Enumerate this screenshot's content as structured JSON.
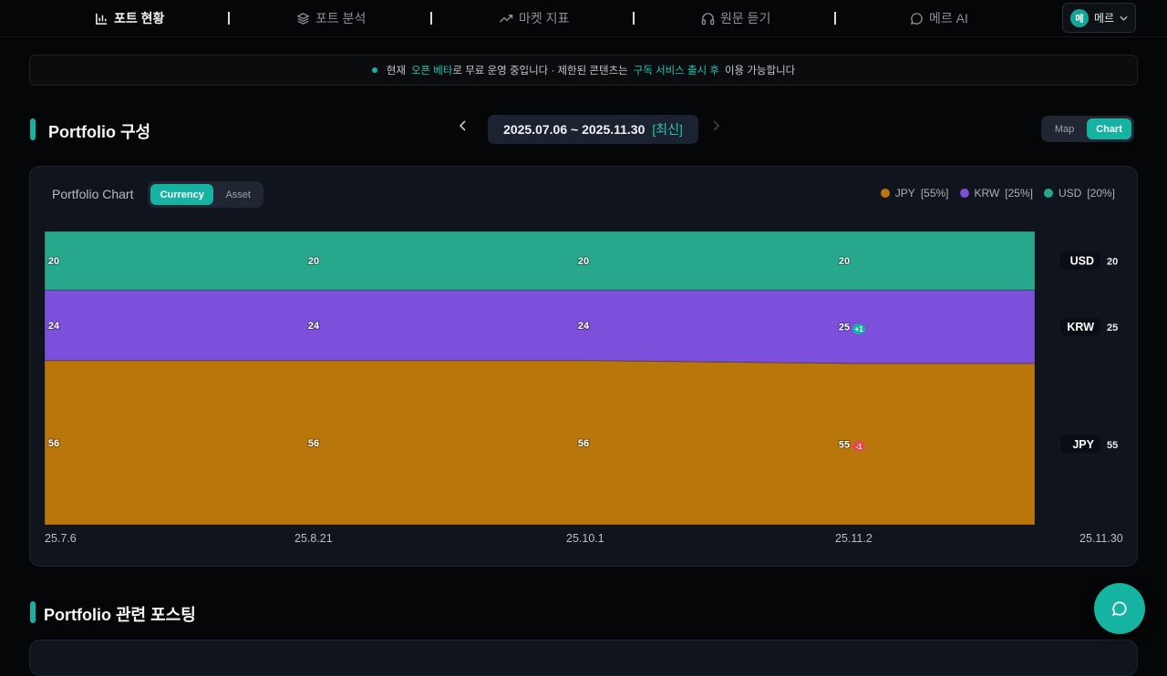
{
  "nav": {
    "items": [
      {
        "label": "포트 현황",
        "icon": "bar-chart-icon",
        "active": true
      },
      {
        "label": "포트 분석",
        "icon": "layers-icon",
        "active": false
      },
      {
        "label": "마켓 지표",
        "icon": "trend-up-icon",
        "active": false
      },
      {
        "label": "원문 듣기",
        "icon": "headphones-icon",
        "active": false
      },
      {
        "label": "메르 AI",
        "icon": "chat-bubble-icon",
        "active": false
      }
    ],
    "user": {
      "avatar_text": "메",
      "name": "메르"
    }
  },
  "banner": {
    "prefix": "현재",
    "hl1": "오픈 베타",
    "mid": "로 무료 운영 중입니다 · 제한된 콘텐츠는",
    "hl2": "구독 서비스 출시 후",
    "suffix": "이용 가능합니다"
  },
  "portfolio": {
    "title": "Portfolio 구성",
    "date_range": "2025.07.06 ~ 2025.11.30",
    "date_tag": "[최신]",
    "view_toggle": {
      "map": "Map",
      "chart": "Chart",
      "selected": "Chart"
    }
  },
  "chart_card": {
    "title": "Portfolio Chart",
    "mode_toggle": {
      "currency": "Currency",
      "asset": "Asset",
      "selected": "Currency"
    },
    "legend": [
      {
        "name": "JPY",
        "pct": "[55%]",
        "color": "#b8760b"
      },
      {
        "name": "KRW",
        "pct": "[25%]",
        "color": "#7c50db"
      },
      {
        "name": "USD",
        "pct": "[20%]",
        "color": "#27a88d"
      }
    ]
  },
  "chart_data": {
    "type": "area",
    "stacked": true,
    "normalized": true,
    "x": [
      "25.7.6",
      "25.8.21",
      "25.10.1",
      "25.11.2",
      "25.11.30"
    ],
    "series": [
      {
        "name": "JPY",
        "color": "#b8760b",
        "values": [
          56,
          56,
          56,
          55,
          55
        ],
        "labels": [
          "56",
          "56",
          "56",
          "55"
        ],
        "change": [
          null,
          null,
          null,
          "-1"
        ],
        "end_value": "55"
      },
      {
        "name": "KRW",
        "color": "#7c50db",
        "values": [
          24,
          24,
          24,
          25,
          25
        ],
        "labels": [
          "24",
          "24",
          "24",
          "25"
        ],
        "change": [
          null,
          null,
          null,
          "+1"
        ],
        "end_value": "25"
      },
      {
        "name": "USD",
        "color": "#27a88d",
        "values": [
          20,
          20,
          20,
          20,
          20
        ],
        "labels": [
          "20",
          "20",
          "20",
          "20"
        ],
        "change": [
          null,
          null,
          null,
          null
        ],
        "end_value": "20"
      }
    ],
    "change_colors": {
      "up": "#16b3a2",
      "down": "#e5484d"
    }
  },
  "postings": {
    "title": "Portfolio 관련 포스팅"
  },
  "fab": {
    "icon": "chat-bubble-icon"
  }
}
